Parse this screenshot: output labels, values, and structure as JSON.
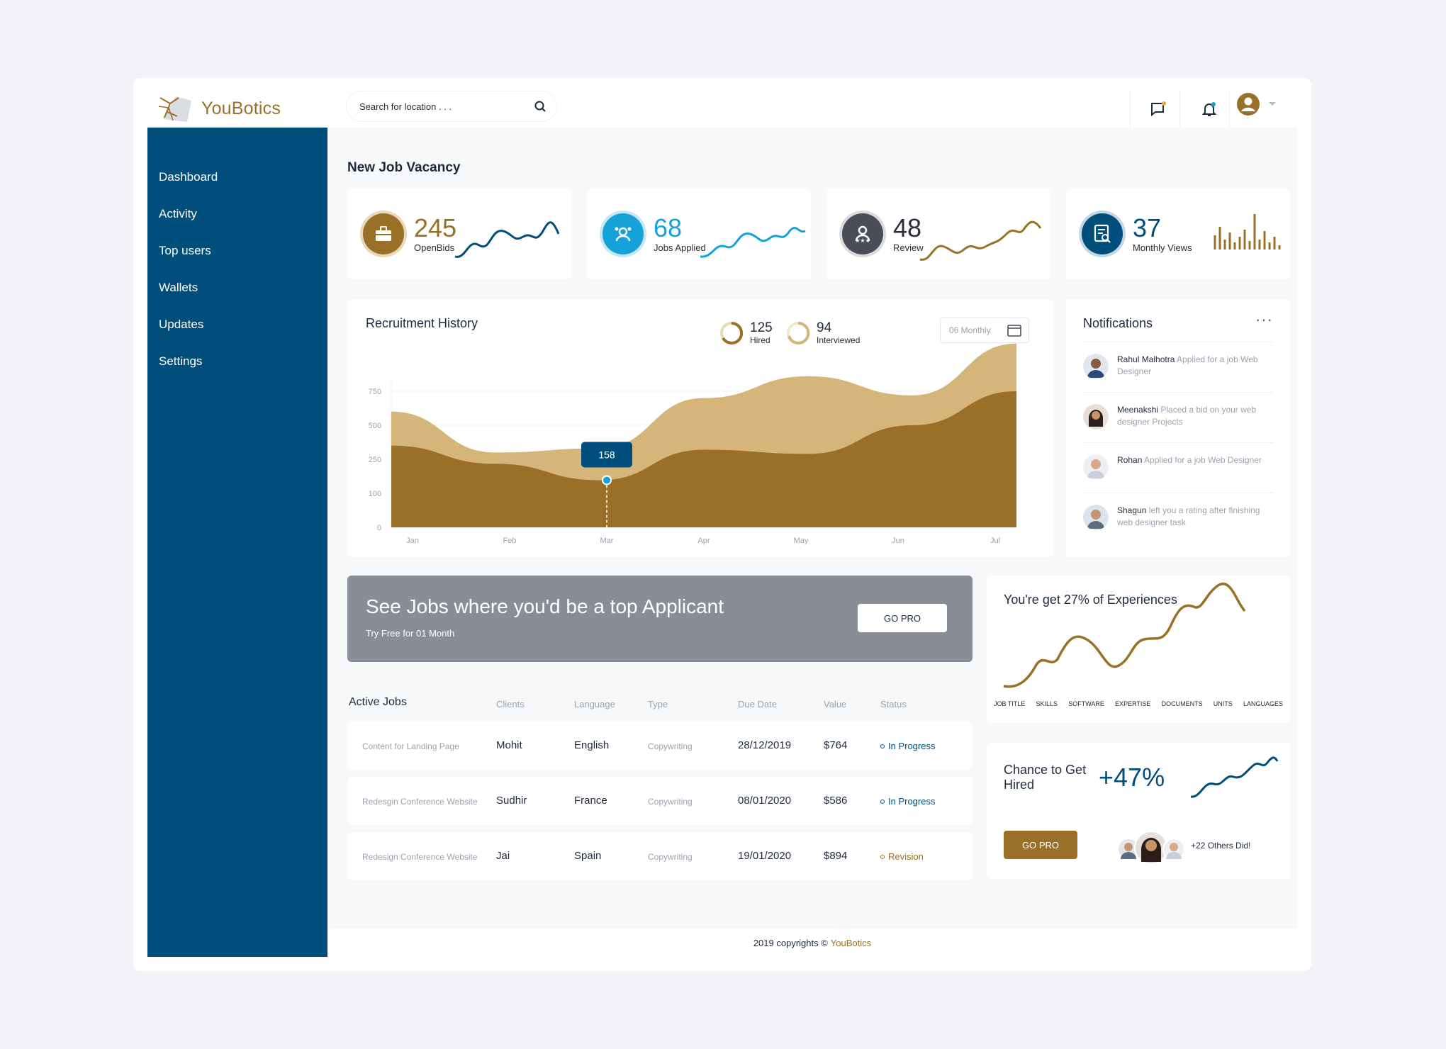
{
  "app": {
    "brand": "YouBotics"
  },
  "search": {
    "placeholder": "Search for location . . ."
  },
  "header": {
    "icons": [
      "chat-icon",
      "bell-icon",
      "user-avatar-icon",
      "chevron-down-icon"
    ]
  },
  "sidebar": {
    "items": [
      {
        "label": "Dashboard"
      },
      {
        "label": "Activity"
      },
      {
        "label": "Top users"
      },
      {
        "label": "Wallets"
      },
      {
        "label": "Updates"
      },
      {
        "label": "Settings"
      }
    ]
  },
  "main": {
    "section_title": "New Job Vacancy"
  },
  "stats": [
    {
      "value": "245",
      "label": "OpenBids",
      "color": "#9a7029",
      "icon": "briefcase-icon"
    },
    {
      "value": "68",
      "label": "Jobs Applied",
      "color": "#15a2d8",
      "icon": "applicant-icon"
    },
    {
      "value": "48",
      "label": "Review",
      "color": "#4a4d58",
      "icon": "review-icon"
    },
    {
      "value": "37",
      "label": "Monthly Views",
      "color": "#004e7b",
      "icon": "document-search-icon"
    }
  ],
  "recruitment": {
    "title": "Recruitment History",
    "hired": {
      "value": "125",
      "label": "Hired"
    },
    "interviewed": {
      "value": "94",
      "label": "Interviewed"
    },
    "period": "06 Monthly",
    "tooltip": "158"
  },
  "chart_data": {
    "type": "area",
    "categories": [
      "Jan",
      "Feb",
      "Mar",
      "Apr",
      "May",
      "Jun",
      "Jul"
    ],
    "y_ticks": [
      0,
      100,
      250,
      500,
      750
    ],
    "series": [
      {
        "values": [
          600,
          300,
          330,
          700,
          860,
          720,
          1100
        ],
        "color": "#d6b57a"
      },
      {
        "values": [
          350,
          230,
          158,
          320,
          290,
          500,
          750
        ],
        "color": "#9a7029"
      }
    ],
    "grid": true,
    "highlight": {
      "category": "Mar",
      "value": 158
    }
  },
  "notifications": {
    "title": "Notifications",
    "items": [
      {
        "name": "Rahul Malhotra",
        "text": "Applied for a job Web Designer"
      },
      {
        "name": "Meenakshi",
        "text": "Placed a bid on your web designer Projects"
      },
      {
        "name": "Rohan",
        "text": "Applied for a job Web Designer"
      },
      {
        "name": "Shagun",
        "text": "left you a rating after finishing web designer task"
      }
    ]
  },
  "promo": {
    "title": "See Jobs where you'd be a top Applicant",
    "subtitle": "Try Free for 01 Month",
    "button": "GO PRO"
  },
  "active_jobs": {
    "headers": [
      "Active Jobs",
      "Clients",
      "Language",
      "Type",
      "Due Date",
      "Value",
      "Status"
    ],
    "rows": [
      {
        "title": "Content for Landing Page",
        "client": "Mohit",
        "language": "English",
        "type": "Copywriting",
        "due": "28/12/2019",
        "value": "$764",
        "status": "In Progress",
        "status_color": "#004e7b"
      },
      {
        "title": "Redesgin Conference Website",
        "client": "Sudhir",
        "language": "France",
        "type": "Copywriting",
        "due": "08/01/2020",
        "value": "$586",
        "status": "In Progress",
        "status_color": "#004e7b"
      },
      {
        "title": "Redesign Conference Website",
        "client": "Jai",
        "language": "Spain",
        "type": "Copywriting",
        "due": "19/01/2020",
        "value": "$894",
        "status": "Revision",
        "status_color": "#9a7029"
      }
    ]
  },
  "experience": {
    "title": "You're get 27% of Experiences",
    "axis": [
      "JOB TITLE",
      "SKILLS",
      "SOFTWARE",
      "EXPERTISE",
      "DOCUMENTS",
      "UNITS",
      "LANGUAGES"
    ]
  },
  "chance": {
    "label": "Chance to Get Hired",
    "value": "+47%",
    "button": "GO PRO",
    "others": "+22 Others Did!"
  },
  "footer": {
    "text": "2019 copyrights ©",
    "brand": "YouBotics"
  }
}
